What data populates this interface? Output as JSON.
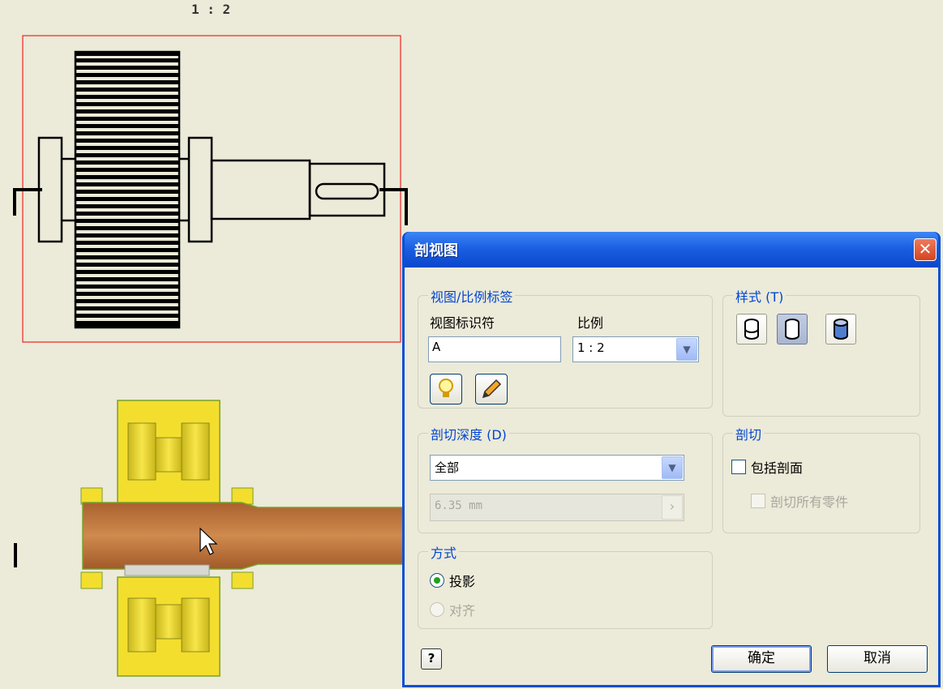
{
  "canvas": {
    "scale_label": "1 : 2"
  },
  "dialog": {
    "title": "剖视图",
    "close_label": "✕",
    "view_scale_group": {
      "legend": "视图/比例标签",
      "identifier_label": "视图标识符",
      "identifier_value": "A",
      "scale_label": "比例",
      "scale_value": "1 : 2"
    },
    "style_group": {
      "legend": "样式 (T)"
    },
    "depth_group": {
      "legend": "剖切深度 (D)",
      "depth_value": "全部",
      "distance_value": "6.35 mm"
    },
    "cut_group": {
      "legend": "剖切",
      "include_slice": "包括剖面",
      "slice_all_parts": "剖切所有零件"
    },
    "method_group": {
      "legend": "方式",
      "projected": "投影",
      "aligned": "对齐"
    },
    "ok_label": "确定",
    "cancel_label": "取消",
    "help_label": "?"
  },
  "colors": {
    "accent": "#0046d5",
    "selection_border": "#ee2222",
    "part_yellow": "#f2dc2c",
    "shaft_copper": "#c57a40"
  }
}
